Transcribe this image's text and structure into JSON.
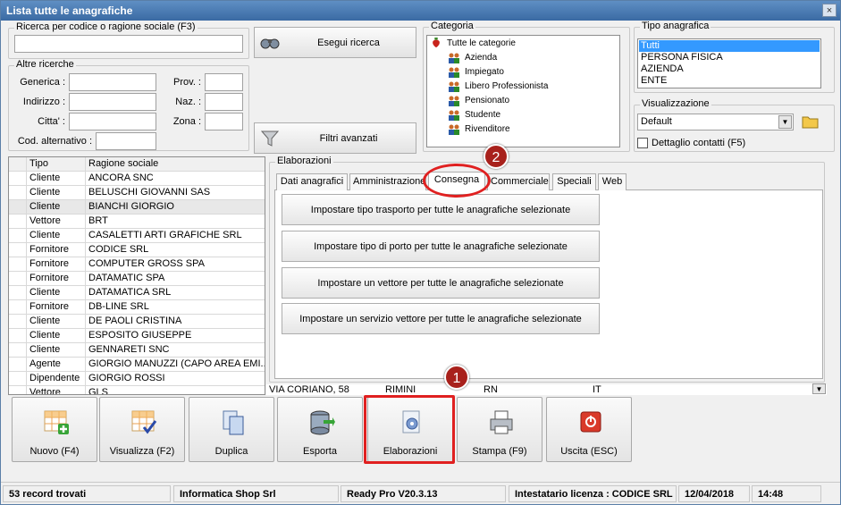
{
  "window": {
    "title": "Lista tutte le anagrafiche",
    "close_label": "×"
  },
  "search": {
    "group_title": "Ricerca per codice o ragione sociale (F3)",
    "value": "",
    "execute_label": "Esegui ricerca"
  },
  "other": {
    "group_title": "Altre ricerche",
    "generica_label": "Generica :",
    "indirizzo_label": "Indirizzo :",
    "citta_label": "Citta' :",
    "cod_alt_label": "Cod. alternativo :",
    "prov_label": "Prov. :",
    "naz_label": "Naz. :",
    "zona_label": "Zona :",
    "filters_label": "Filtri avanzati"
  },
  "category": {
    "group_title": "Categoria",
    "items": [
      "Tutte le categorie",
      "Azienda",
      "Impiegato",
      "Libero Professionista",
      "Pensionato",
      "Studente",
      "Rivenditore"
    ]
  },
  "tipo": {
    "group_title": "Tipo anagrafica",
    "items": [
      "Tutti",
      "PERSONA FISICA",
      "AZIENDA",
      "ENTE"
    ],
    "selected": "Tutti"
  },
  "visual": {
    "group_title": "Visualizzazione",
    "value": "Default",
    "detail_label": "Dettaglio contatti (F5)"
  },
  "grid": {
    "headers": [
      "Tipo",
      "Ragione sociale"
    ],
    "rows": [
      [
        "Cliente",
        "ANCORA SNC"
      ],
      [
        "Cliente",
        "BELUSCHI GIOVANNI SAS"
      ],
      [
        "Cliente",
        "BIANCHI GIORGIO"
      ],
      [
        "Vettore",
        "BRT"
      ],
      [
        "Cliente",
        "CASALETTI ARTI GRAFICHE SRL"
      ],
      [
        "Fornitore",
        "CODICE SRL"
      ],
      [
        "Fornitore",
        "COMPUTER GROSS SPA"
      ],
      [
        "Fornitore",
        "DATAMATIC SPA"
      ],
      [
        "Cliente",
        "DATAMATICA SRL"
      ],
      [
        "Fornitore",
        "DB-LINE SRL"
      ],
      [
        "Cliente",
        "DE PAOLI CRISTINA"
      ],
      [
        "Cliente",
        "ESPOSITO GIUSEPPE"
      ],
      [
        "Cliente",
        "GENNARETI SNC"
      ],
      [
        "Agente",
        "GIORGIO MANUZZI (CAPO AREA EMI..."
      ],
      [
        "Dipendente",
        "GIORGIO ROSSI"
      ],
      [
        "Vettore",
        "GLS"
      ]
    ],
    "partial_row": [
      "VIA CORIANO, 58",
      "RIMINI",
      "RN",
      "IT"
    ]
  },
  "elab": {
    "group_title": "Elaborazioni",
    "tabs": [
      "Dati anagrafici",
      "Amministrazione",
      "Consegna",
      "Commerciale",
      "Speciali",
      "Web"
    ],
    "active_tab": "Consegna",
    "actions": [
      "Impostare tipo trasporto per tutte le anagrafiche selezionate",
      "Impostare tipo di porto per tutte le anagrafiche selezionate",
      "Impostare un vettore per tutte le anagrafiche selezionate",
      "Impostare un servizio vettore per tutte le anagrafiche selezionate"
    ]
  },
  "toolbar": {
    "buttons": [
      "Nuovo (F4)",
      "Visualizza (F2)",
      "Duplica",
      "Esporta",
      "Elaborazioni",
      "Stampa (F9)",
      "Uscita (ESC)"
    ],
    "icons": [
      "grid-add-icon",
      "grid-check-icon",
      "duplicate-icon",
      "database-export-icon",
      "gear-document-icon",
      "printer-icon",
      "exit-icon"
    ]
  },
  "annotations": {
    "badge1": "1",
    "badge2": "2"
  },
  "status": {
    "records": "53 record trovati",
    "company": "Informatica Shop Srl",
    "version": "Ready Pro V20.3.13",
    "license": "Intestatario licenza : CODICE SRL",
    "date": "12/04/2018",
    "time": "14:48"
  },
  "colors": {
    "selection": "#3399ff",
    "highlight": "#e02020",
    "badge": "#a8211c",
    "titlebar": "#3a6aa3"
  }
}
